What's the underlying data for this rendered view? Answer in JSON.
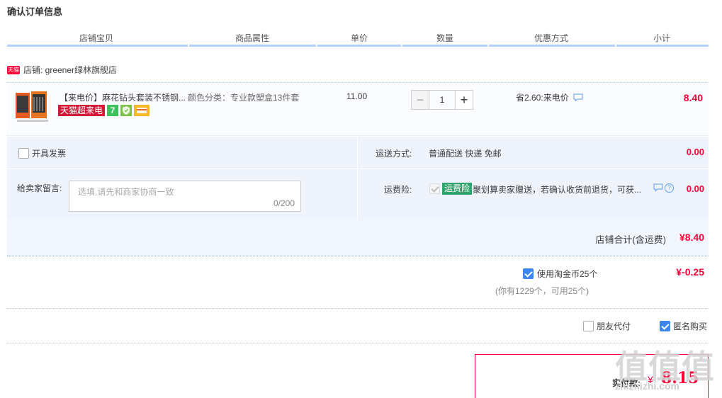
{
  "page_title": "确认订单信息",
  "columns": [
    "店铺宝贝",
    "商品属性",
    "单价",
    "数量",
    "优惠方式",
    "小计"
  ],
  "shop": {
    "badge": "天猫",
    "label": "店铺: greener绿林旗舰店"
  },
  "item": {
    "title": "【来电价】麻花钻头套装不锈钢...",
    "badge_tmall": "天猫超来电",
    "badge_7": "7",
    "attr": "颜色分类：专业款塑盒13件套",
    "price": "11.00",
    "qty_minus": "−",
    "qty": "1",
    "qty_plus": "+",
    "discount": "省2.60:来电价",
    "subtotal": "8.40"
  },
  "invoice_label": "开具发票",
  "message": {
    "label": "给卖家留言:",
    "placeholder": "选填,请先和商家协商一致",
    "count": "0/200"
  },
  "shipping": {
    "label": "运送方式:",
    "value": "普通配送 快递 免邮",
    "fee": "0.00"
  },
  "insurance": {
    "label": "运费险:",
    "tag": "运费险",
    "desc": "聚划算卖家赠送，若确认收货前退货，可获...",
    "help": "?",
    "fee": "0.00"
  },
  "shop_total": {
    "label": "店铺合计(含运费)",
    "value": "¥8.40"
  },
  "coin": {
    "label": "使用淘金币25个",
    "deduct": "¥-0.25",
    "sub": "(你有1229个，可用25个)"
  },
  "friend_pay": "朋友代付",
  "anonymous": "匿名购买",
  "payment": {
    "label": "实付款:",
    "currency": "¥",
    "value": "8.15"
  },
  "watermark": {
    "main": "值值值",
    "sub": "zhizhizhi.com"
  },
  "colors": {
    "accent_red": "#ff0036",
    "header_border": "#b2d1ff",
    "check_blue": "#3c87f4"
  }
}
